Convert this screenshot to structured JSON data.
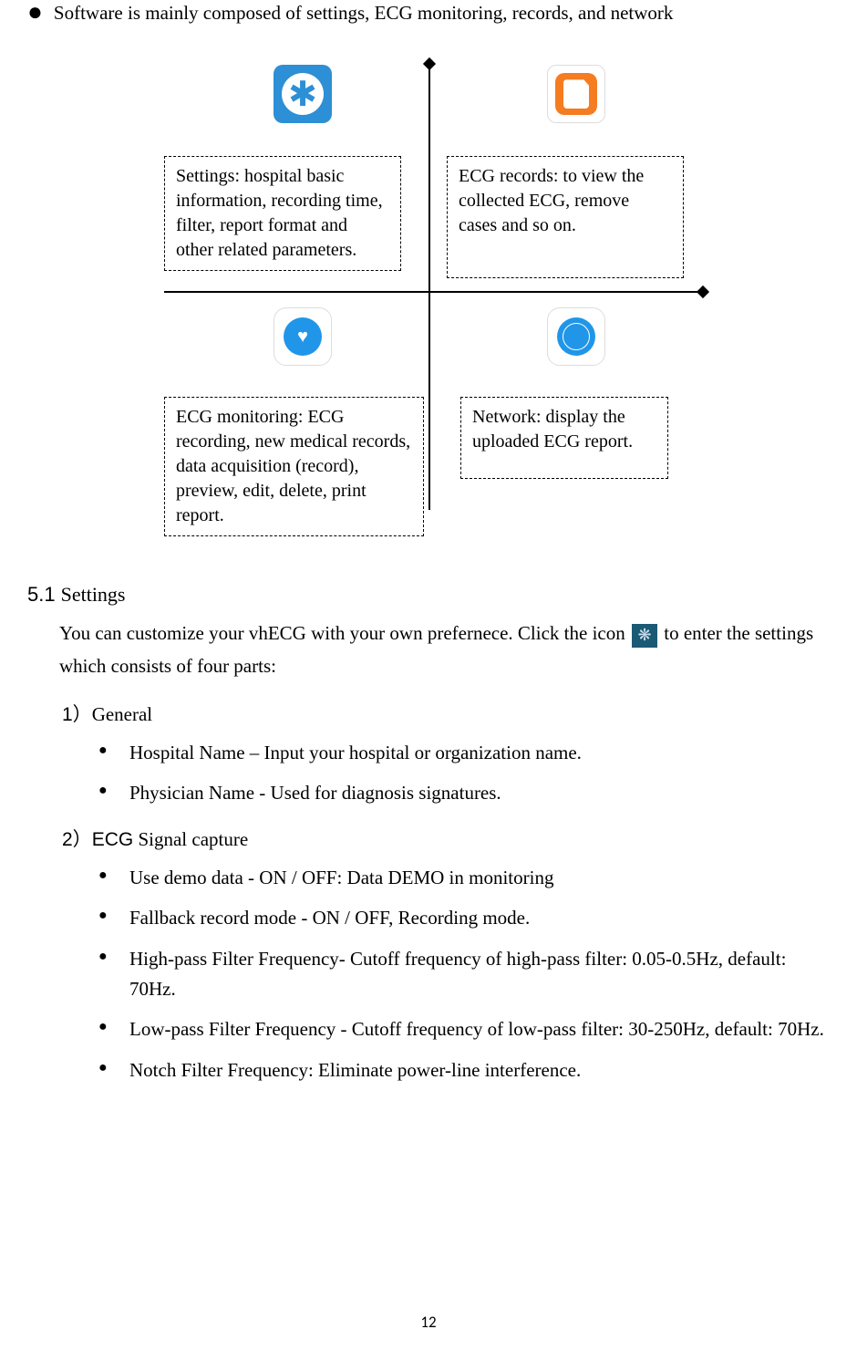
{
  "intro": "Software is mainly composed of settings, ECG monitoring, records, and network",
  "diagram": {
    "box1": "Settings: hospital basic information, recording time, filter, report format and other related parameters.",
    "box2": "ECG records: to view the collected ECG, remove cases and so on.",
    "box3": "ECG monitoring: ECG recording, new medical records, data acquisition (record), preview, edit, delete, print report.",
    "box4": "Network: display the uploaded ECG report."
  },
  "section": {
    "num": "5.1",
    "title": "Settings",
    "para_before": "You can customize your vhECG with your own prefernece. Click the icon ",
    "para_after": "to enter the settings which consists of four parts:"
  },
  "sub1": {
    "num": "1）",
    "title": "General",
    "items": [
      "Hospital Name – Input your hospital or organization name.",
      "Physician Name - Used for diagnosis signatures."
    ]
  },
  "sub2": {
    "num": "2）",
    "label": "ECG",
    "title": " Signal capture",
    "items": [
      "Use demo data - ON / OFF: Data DEMO in monitoring",
      "Fallback record mode - ON / OFF, Recording mode.",
      "High-pass Filter Frequency- Cutoff frequency of high-pass filter: 0.05-0.5Hz, default: 70Hz.",
      "Low-pass Filter Frequency - Cutoff frequency of low-pass filter: 30-250Hz, default: 70Hz.",
      "Notch Filter Frequency: Eliminate power-line interference."
    ]
  },
  "page_number": "12"
}
